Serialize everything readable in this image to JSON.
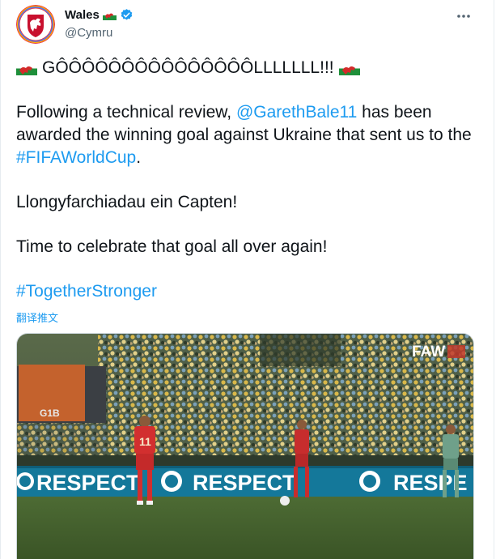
{
  "account": {
    "display_name": "Wales",
    "handle": "@Cymru",
    "verified": true,
    "name_emoji": "wales-flag-icon",
    "avatar": "faw-crest-icon"
  },
  "tweet": {
    "line1_text": "GÔÔÔÔÔÔÔÔÔÔÔÔÔÔÔLLLLLLL!!!",
    "line1_emoji": "wales-flag-icon",
    "para2_before": "Following a technical review, ",
    "mention": "@GarethBale11",
    "para2_middle": " has been awarded the winning goal against Ukraine that sent us to the ",
    "hashtag_fifa": "#FIFAWorldCup",
    "para2_end": ".",
    "para3": "Llongyfarchiadau ein Capten!",
    "para4": "Time to celebrate that goal all over again!",
    "hashtag_together": "#TogetherStronger"
  },
  "translate_label": "翻译推文",
  "media": {
    "watermark": "FAW",
    "ad_boards": [
      "RESPECT",
      "RESPECT",
      "RESPE"
    ],
    "player_number": "11",
    "stand_sign": "G1B"
  },
  "colors": {
    "link": "#1d9bf0",
    "text": "#0f1419",
    "secondary": "#536471",
    "wales_red": "#d42a2a",
    "wales_green": "#1f8f3a"
  },
  "menu_icon": "more-icon"
}
